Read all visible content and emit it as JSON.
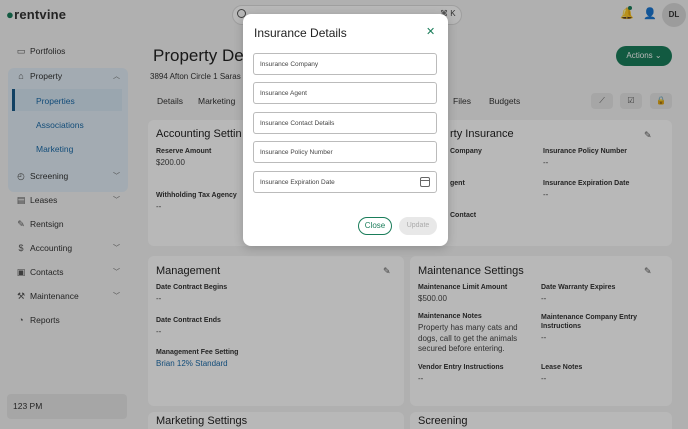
{
  "brand": {
    "logo_text": "rentvine",
    "accent": "#1a7d5a"
  },
  "top": {
    "search_placeholder": "Search",
    "shortcut": "⌘ K",
    "avatar": "DL",
    "icons": [
      "bell-icon",
      "user-icon"
    ]
  },
  "sidebar": {
    "items": [
      {
        "label": "Portfolios",
        "icon": "portfolio-icon"
      },
      {
        "label": "Property",
        "icon": "property-icon"
      },
      {
        "label": "Screening",
        "icon": "screening-icon"
      },
      {
        "label": "Leases",
        "icon": "leases-icon"
      },
      {
        "label": "Rentsign",
        "icon": "rentsign-icon"
      },
      {
        "label": "Accounting",
        "icon": "accounting-icon"
      },
      {
        "label": "Contacts",
        "icon": "contacts-icon"
      },
      {
        "label": "Maintenance",
        "icon": "maintenance-icon"
      },
      {
        "label": "Reports",
        "icon": "reports-icon"
      }
    ],
    "property_sub": [
      "Properties",
      "Associations",
      "Marketing"
    ],
    "time": "123 PM"
  },
  "main": {
    "title": "Property Det",
    "address": "3894 Afton Circle 1 Saras",
    "actions_label": "Actions",
    "tabs": [
      "Details",
      "Marketing",
      "Files",
      "Budgets"
    ],
    "accounting": {
      "title": "Accounting Settin",
      "reserve_label": "Reserve Amount",
      "reserve_value": "$200.00",
      "withholding_label": "Withholding Tax Agency",
      "withholding_value": "--"
    },
    "insurance": {
      "title": "rty Insurance",
      "company_label": "Company",
      "policy_label": "Insurance Policy Number",
      "policy_value": "--",
      "agent_label": "gent",
      "expiration_label": "Insurance Expiration Date",
      "expiration_value": "--",
      "contact_label": "Contact"
    },
    "management": {
      "title": "Management",
      "begins_label": "Date Contract Begins",
      "begins_value": "--",
      "ends_label": "Date Contract Ends",
      "ends_value": "--",
      "fee_label": "Management Fee Setting",
      "fee_value": "Brian 12% Standard"
    },
    "maintenance": {
      "title": "Maintenance Settings",
      "limit_label": "Maintenance Limit Amount",
      "limit_value": "$500.00",
      "warranty_label": "Date Warranty Expires",
      "warranty_value": "--",
      "notes_label": "Maintenance Notes",
      "notes_value": "Property has many cats and dogs, call to get the animals secured before entering.",
      "entry_label": "Maintenance Company Entry Instructions",
      "entry_value": "--",
      "vendor_label": "Vendor Entry Instructions",
      "vendor_value": "--",
      "lease_label": "Lease Notes",
      "lease_value": "--"
    },
    "bottom_left_title": "Marketing Settings",
    "bottom_right_title": "Screening"
  },
  "modal": {
    "title": "Insurance Details",
    "fields": [
      "Insurance Company",
      "Insurance Agent",
      "Insurance Contact Details",
      "Insurance Policy Number",
      "Insurance Expiration Date"
    ],
    "close_label": "Close",
    "update_label": "Update"
  }
}
